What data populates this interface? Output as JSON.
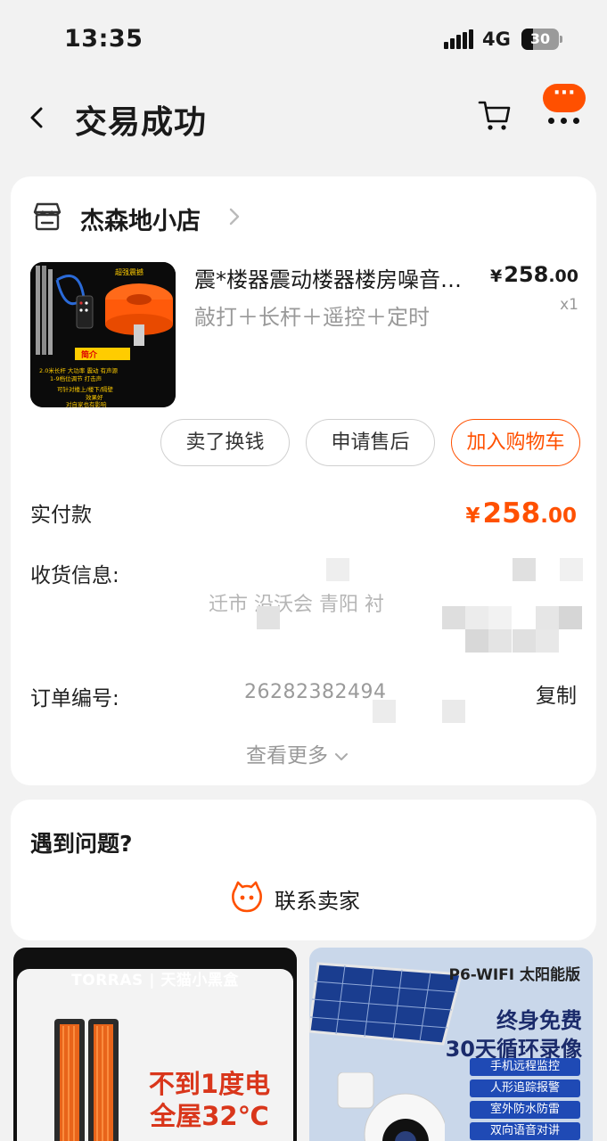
{
  "status_bar": {
    "time": "13:35",
    "network": "4G",
    "battery": "30",
    "battery_level": 0.3
  },
  "nav": {
    "title": "交易成功"
  },
  "store": {
    "name": "杰森地小店"
  },
  "product": {
    "title": "震*楼器震动楼器楼房噪音反击",
    "spec": "敲打＋长杆＋遥控＋定时",
    "price_currency": "¥",
    "price_int": "258",
    "price_dec": ".00",
    "quantity": "x1"
  },
  "actions": {
    "sell": "卖了换钱",
    "after_sale": "申请售后",
    "add_cart": "加入购物车"
  },
  "payment": {
    "label": "实付款",
    "currency": "¥",
    "amount_int": "258",
    "amount_dec": ".00"
  },
  "shipping": {
    "label": "收货信息:",
    "address_partial": "迁市 沿沃会 青阳 衬"
  },
  "order": {
    "label": "订单编号:",
    "number": "26282382494",
    "copy": "复制"
  },
  "view_more": "查看更多",
  "help": {
    "title": "遇到问题?",
    "contact": "联系卖家"
  },
  "recommendations": [
    {
      "brand": "TORRAS | 天猫小黑盒",
      "headline_1": "不到1度电",
      "headline_2": "全屋32℃"
    },
    {
      "model": "P6-WIFI 太阳能版",
      "ad_1": "终身免费",
      "ad_2": "30天循环录像",
      "features": [
        "手机远程监控",
        "人形追踪报警",
        "室外防水防雷",
        "双向语音对讲"
      ]
    }
  ],
  "colors": {
    "accent": "#ff5000",
    "background": "#f2f2f2",
    "card": "#ffffff"
  }
}
